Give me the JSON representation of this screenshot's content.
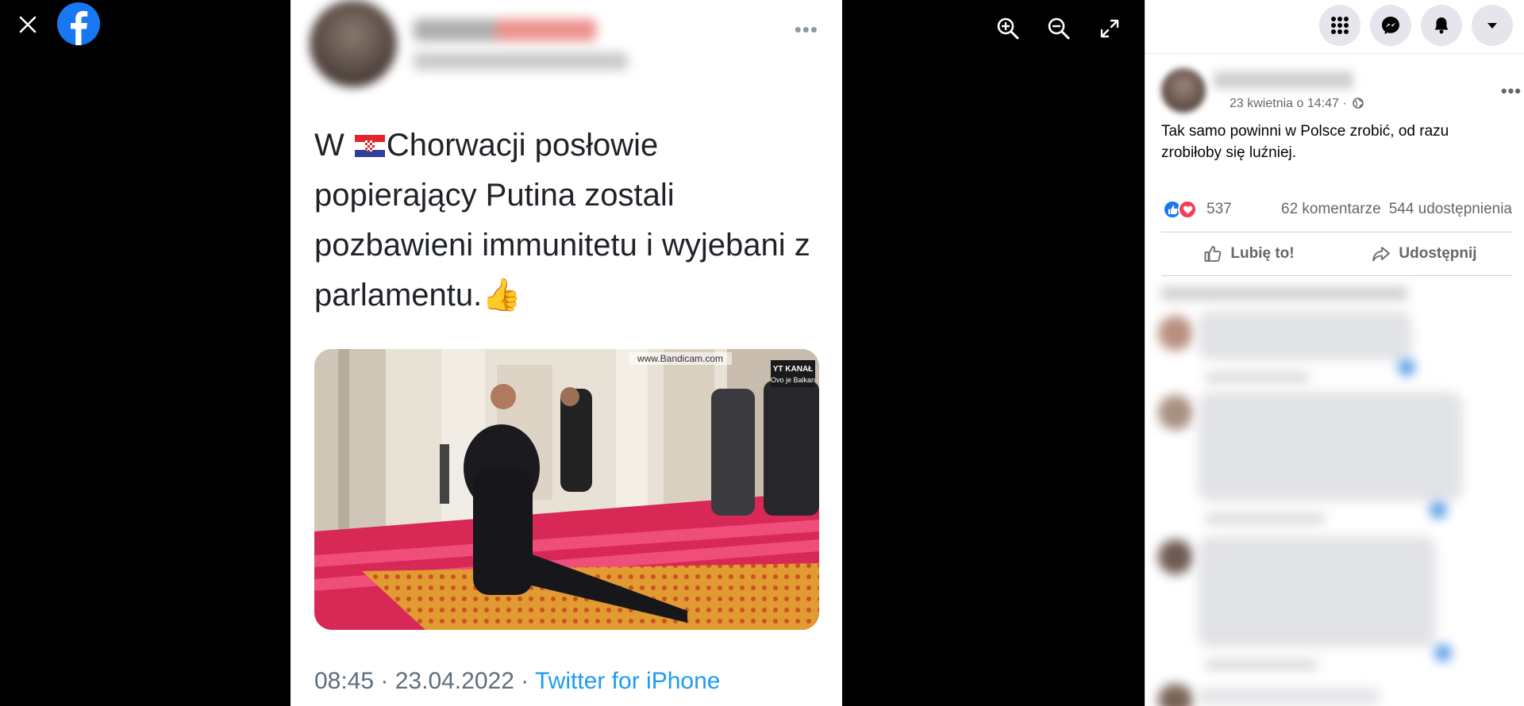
{
  "viewer": {
    "tools": [
      "zoom-in-icon",
      "zoom-out-icon",
      "fullscreen-icon"
    ]
  },
  "tweet": {
    "text_before_flag": "W ",
    "text_after_flag": "Chorwacji posłowie popierający Putina zostali pozbawieni immunitetu i wyjebani z parlamentu.",
    "emoji": "👍",
    "media_watermark": "www.Bandicam.com",
    "media_badge_line1": "YT KANAŁ",
    "media_badge_line2": "Ovo je Balkan",
    "meta_time": "08:45 · 23.04.2022 · ",
    "meta_source": "Twitter for iPhone"
  },
  "post": {
    "timestamp": "23 kwietnia o 14:47 ·",
    "text": "Tak samo powinni w Polsce zrobić, od razu zrobiłoby się luźniej.",
    "reaction_count": "537",
    "comments": "62 komentarze",
    "shares": "544 udostępnienia",
    "like_label": "Lubię to!",
    "share_label": "Udostępnij"
  },
  "colors": {
    "facebook_blue": "#1877f2",
    "love_red": "#f33e58",
    "twitter_blue": "#1d9bf0"
  }
}
